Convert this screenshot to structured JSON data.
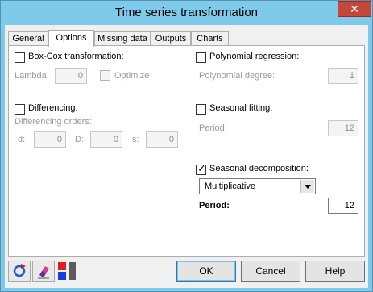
{
  "window": {
    "title": "Time series transformation",
    "close_glyph": "✕"
  },
  "tabs": [
    {
      "label": "General"
    },
    {
      "label": "Options"
    },
    {
      "label": "Missing data"
    },
    {
      "label": "Outputs"
    },
    {
      "label": "Charts"
    }
  ],
  "options": {
    "boxcox": {
      "label": "Box-Cox transformation:",
      "checked": false
    },
    "lambda": {
      "label": "Lambda:",
      "value": "0"
    },
    "optimize": {
      "label": "Optimize",
      "checked": false
    },
    "differencing": {
      "label": "Differencing:",
      "checked": false
    },
    "diff_orders_label": "Differencing orders:",
    "d": {
      "label": "d:",
      "value": "0"
    },
    "D": {
      "label": "D:",
      "value": "0"
    },
    "s": {
      "label": "s:",
      "value": "0"
    },
    "polynomial": {
      "label": "Polynomial regression:",
      "checked": false
    },
    "poly_degree": {
      "label": "Polynomial degree:",
      "value": "1"
    },
    "seasonal_fitting": {
      "label": "Seasonal fitting:",
      "checked": false
    },
    "sf_period": {
      "label": "Period:",
      "value": "12"
    },
    "seasonal_decomposition": {
      "label": "Seasonal decomposition:",
      "checked": true,
      "check_glyph": "✓"
    },
    "decomp_type": {
      "value": "Multiplicative"
    },
    "sd_period": {
      "label": "Period:",
      "value": "12"
    }
  },
  "buttons": {
    "ok": "OK",
    "cancel": "Cancel",
    "help": "Help"
  },
  "icons": [
    "reset-icon",
    "eraser-icon",
    "layout-toggle-icon"
  ],
  "colors": {
    "title_bar": "#7ecaea",
    "close": "#c7463a",
    "dialog": "#f0f0f0"
  }
}
